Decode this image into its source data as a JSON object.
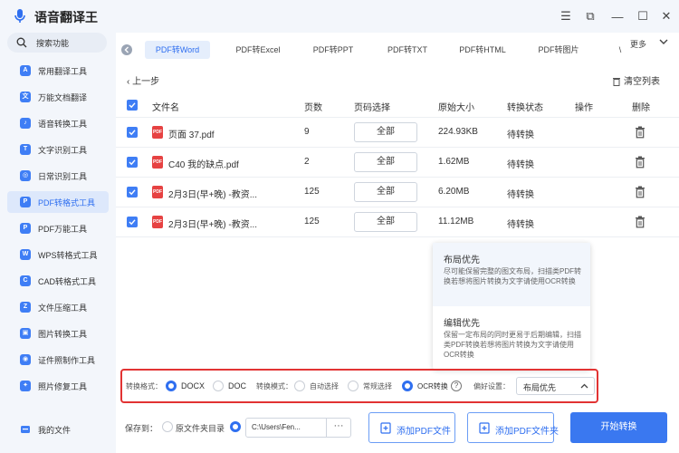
{
  "app": {
    "title": "语音翻译王"
  },
  "window_controls": [
    {
      "name": "menu-icon",
      "glyph": "☰"
    },
    {
      "name": "compact-icon",
      "glyph": "⧉"
    },
    {
      "name": "minimize-icon",
      "glyph": "—"
    },
    {
      "name": "maximize-icon",
      "glyph": "☐"
    },
    {
      "name": "close-icon",
      "glyph": "✕"
    }
  ],
  "sidebar": {
    "search_label": "搜索功能",
    "items": [
      {
        "label": "常用翻译工具",
        "icon": "A"
      },
      {
        "label": "万能文档翻译",
        "icon": "文"
      },
      {
        "label": "语音转换工具",
        "icon": "♪"
      },
      {
        "label": "文字识别工具",
        "icon": "T"
      },
      {
        "label": "日常识别工具",
        "icon": "◎"
      },
      {
        "label": "PDF转格式工具",
        "icon": "P",
        "active": true
      },
      {
        "label": "PDF万能工具",
        "icon": "P"
      },
      {
        "label": "WPS转格式工具",
        "icon": "W"
      },
      {
        "label": "CAD转格式工具",
        "icon": "C"
      },
      {
        "label": "文件压缩工具",
        "icon": "Z"
      },
      {
        "label": "图片转换工具",
        "icon": "▣"
      },
      {
        "label": "证件照制作工具",
        "icon": "◉"
      },
      {
        "label": "照片修复工具",
        "icon": "✦"
      }
    ],
    "my_files_label": "我的文件"
  },
  "tabs": [
    {
      "label": "PDF转Word",
      "active": true
    },
    {
      "label": "PDF转Excel"
    },
    {
      "label": "PDF转PPT"
    },
    {
      "label": "PDF转TXT"
    },
    {
      "label": "PDF转HTML"
    },
    {
      "label": "PDF转图片"
    },
    {
      "label": "\\"
    }
  ],
  "more_label": "更多",
  "back_label": "上一步",
  "clear_label": "清空列表",
  "table": {
    "headers": [
      "文件名",
      "页数",
      "页码选择",
      "原始大小",
      "转换状态",
      "操作",
      "删除"
    ],
    "rows": [
      {
        "name": "页面 37.pdf",
        "pages": "9",
        "range": "全部",
        "size": "224.93KB",
        "status": "待转换"
      },
      {
        "name": "C40 我的缺点.pdf",
        "pages": "2",
        "range": "全部",
        "size": "1.62MB",
        "status": "待转换"
      },
      {
        "name": "2月3日(早+晚) -教资...",
        "pages": "125",
        "range": "全部",
        "size": "6.20MB",
        "status": "待转换"
      },
      {
        "name": "2月3日(早+晚) -教资...",
        "pages": "125",
        "range": "全部",
        "size": "11.12MB",
        "status": "待转换"
      }
    ]
  },
  "popup": {
    "options": [
      {
        "title": "布局优先",
        "desc": "尽可能保留完整的图文布局，扫描类PDF转换若想将图片转换为文字请使用OCR转换"
      },
      {
        "title": "编辑优先",
        "desc": "保留一定布局的同时更易于后期编辑，扫描类PDF转换若想将图片转换为文字请使用OCR转换"
      }
    ]
  },
  "settings": {
    "format_label": "转换格式：",
    "format_docx": "DOCX",
    "format_doc": "DOC",
    "mode_label": "转换模式：",
    "mode_auto": "自动选择",
    "mode_normal": "常规选择",
    "mode_ocr": "OCR转换",
    "help_glyph": "?",
    "pref_label": "偏好设置：",
    "pref_value": "布局优先"
  },
  "footer": {
    "save_label": "保存到：",
    "source_dir_label": "原文件夹目录",
    "path_value": "C:\\Users\\Fen...",
    "dots": "···",
    "add_file_label": "添加PDF文件",
    "add_folder_label": "添加PDF文件夹",
    "start_label": "开始转换"
  },
  "colors": {
    "accent": "#2f6ff0",
    "highlight": "#e23333",
    "pdf": "#e64242"
  }
}
